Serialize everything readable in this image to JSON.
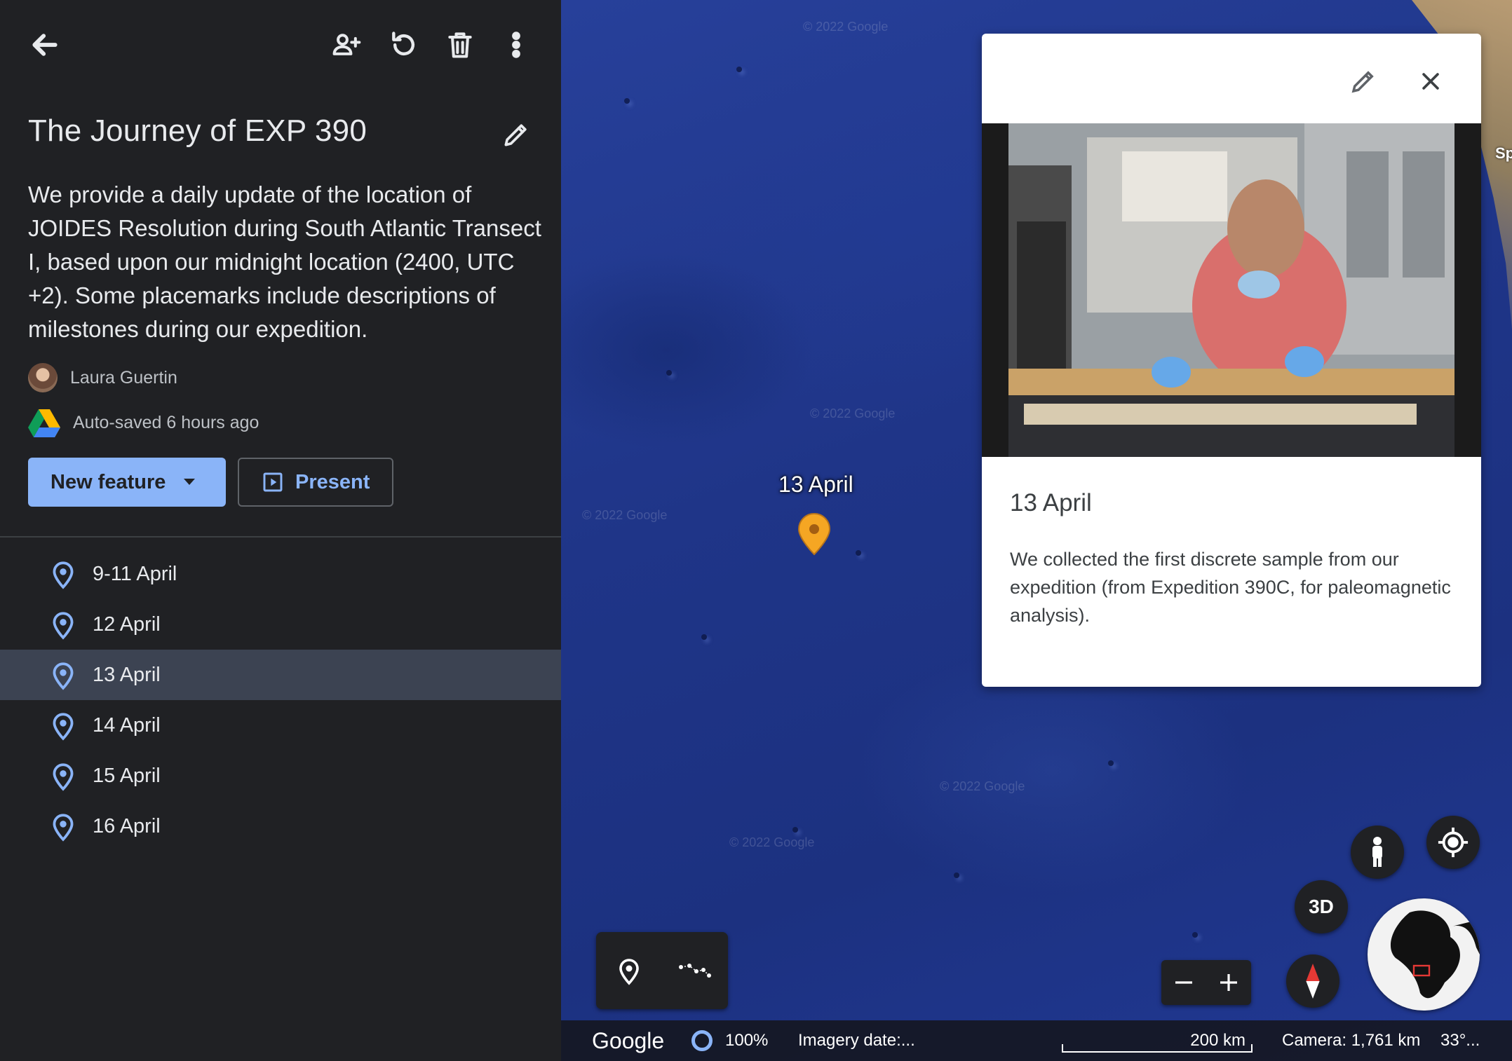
{
  "toolbar": {
    "back_icon": "arrow-back-icon",
    "share_icon": "person-add-icon",
    "undo_icon": "undo-icon",
    "delete_icon": "trash-icon",
    "more_icon": "more-vert-icon"
  },
  "project": {
    "title": "The Journey of EXP 390",
    "description": "We provide a daily update of the location of JOIDES Resolution during South Atlantic Transect I, based upon our midnight location (2400, UTC +2). Some placemarks include descriptions of milestones during our expedition.",
    "author": "Laura Guertin",
    "save_status": "Auto-saved 6 hours ago"
  },
  "actions": {
    "new_feature_label": "New feature",
    "present_label": "Present"
  },
  "features": [
    {
      "label": "9-11 April"
    },
    {
      "label": "12 April"
    },
    {
      "label": "13 April",
      "selected": true
    },
    {
      "label": "14 April"
    },
    {
      "label": "15 April"
    },
    {
      "label": "16 April"
    }
  ],
  "map": {
    "placemark_label": "13 April",
    "watermark": "© 2022 Google",
    "globe_partial_label": "Sp",
    "card": {
      "title": "13 April",
      "description": "We collected the first discrete sample from our expedition (from Expedition 390C, for paleomagnetic analysis)."
    },
    "view_mode_label": "3D",
    "status": {
      "brand": "Google",
      "percent": "100%",
      "imagery": "Imagery date:...",
      "scale": "200 km",
      "camera": "Camera: 1,761 km",
      "coords": "33°..."
    }
  },
  "colors": {
    "accent": "#8ab4f8",
    "panel_bg": "#202124",
    "selected_row": "#3c4352",
    "pin_orange": "#f5a623"
  }
}
